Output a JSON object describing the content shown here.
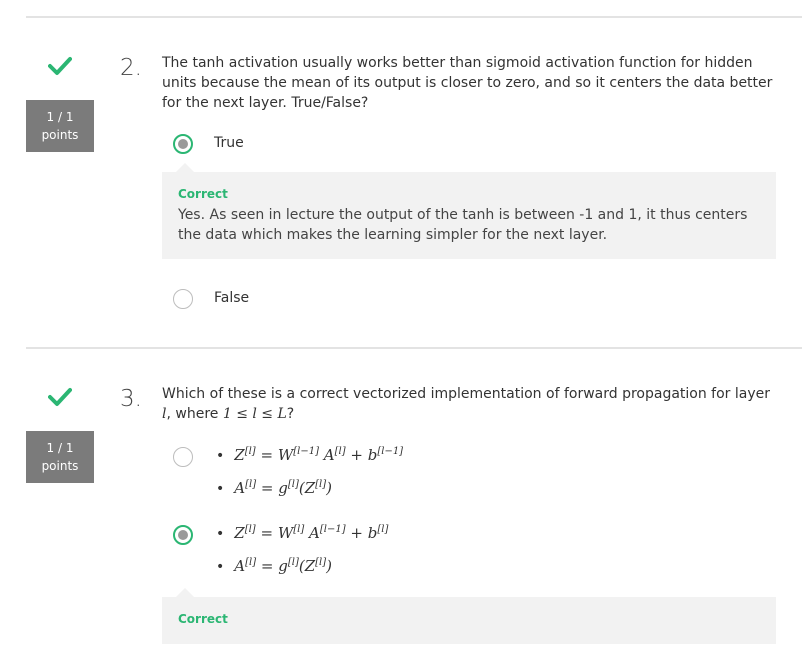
{
  "q2": {
    "number": "2.",
    "score": "1 / 1",
    "score_unit": "points",
    "text": "The tanh activation usually works better than sigmoid activation function for hidden units because the mean of its output is closer to zero, and so it centers the data better for the next layer. True/False?",
    "options": [
      {
        "label": "True",
        "selected": true
      },
      {
        "label": "False",
        "selected": false
      }
    ],
    "feedback": {
      "title": "Correct",
      "text": "Yes. As seen in lecture the output of the tanh is between -1 and 1, it thus centers the data which makes the learning simpler for the next layer."
    }
  },
  "q3": {
    "number": "3.",
    "score": "1 / 1",
    "score_unit": "points",
    "text_prefix": "Which of these is a correct vectorized implementation of forward propagation for layer ",
    "text_var": "l",
    "text_mid": ", where ",
    "text_range": "1 ≤ l ≤ L",
    "text_suffix": "?",
    "options": [
      {
        "selected": false,
        "line1": "Z[l] = W[l−1] A[l] + b[l−1]",
        "line2": "A[l] = g[l](Z[l])"
      },
      {
        "selected": true,
        "line1": "Z[l] = W[l] A[l−1] + b[l]",
        "line2": "A[l] = g[l](Z[l])"
      }
    ],
    "feedback": {
      "title": "Correct"
    }
  },
  "colors": {
    "correct": "#2bb673",
    "score_bg": "#7b7b7b",
    "feedback_bg": "#f2f2f2"
  },
  "icons": {
    "status": "checkmark-icon"
  }
}
